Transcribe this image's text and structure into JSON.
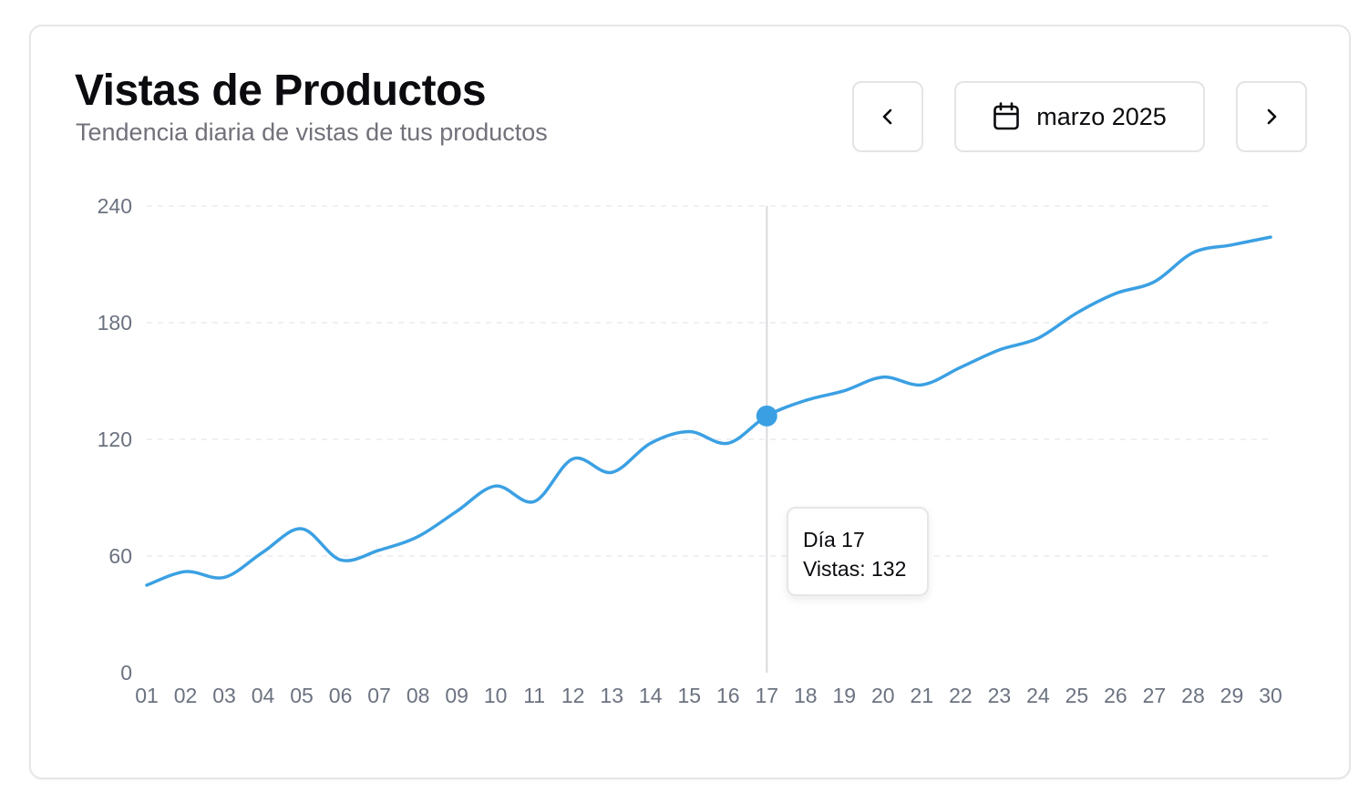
{
  "header": {
    "title": "Vistas de Productos",
    "subtitle": "Tendencia diaria de vistas de tus productos"
  },
  "controls": {
    "prev_icon": "chevron-left-icon",
    "next_icon": "chevron-right-icon",
    "calendar_icon": "calendar-icon",
    "month_label": "marzo 2025"
  },
  "tooltip": {
    "day_label": "Día 17",
    "views_prefix": "Vistas:",
    "views_value": "132"
  },
  "colors": {
    "line": "#3ba0e3",
    "grid": "#ececef",
    "crosshair": "#d9d9de"
  },
  "chart_data": {
    "type": "line",
    "title": "Vistas de Productos",
    "subtitle": "Tendencia diaria de vistas de tus productos",
    "xlabel": "",
    "ylabel": "",
    "categories": [
      "01",
      "02",
      "03",
      "04",
      "05",
      "06",
      "07",
      "08",
      "09",
      "10",
      "11",
      "12",
      "13",
      "14",
      "15",
      "16",
      "17",
      "18",
      "19",
      "20",
      "21",
      "22",
      "23",
      "24",
      "25",
      "26",
      "27",
      "28",
      "29",
      "30"
    ],
    "series": [
      {
        "values": [
          45,
          52,
          49,
          62,
          74,
          58,
          63,
          70,
          83,
          96,
          88,
          110,
          103,
          118,
          124,
          118,
          132,
          140,
          145,
          152,
          148,
          157,
          166,
          172,
          185,
          195,
          201,
          216,
          220,
          224
        ]
      }
    ],
    "ylim": [
      0,
      240
    ],
    "yticks": [
      0,
      60,
      120,
      180,
      240
    ],
    "grid": true,
    "highlight": {
      "category": "17",
      "value": 132
    }
  }
}
